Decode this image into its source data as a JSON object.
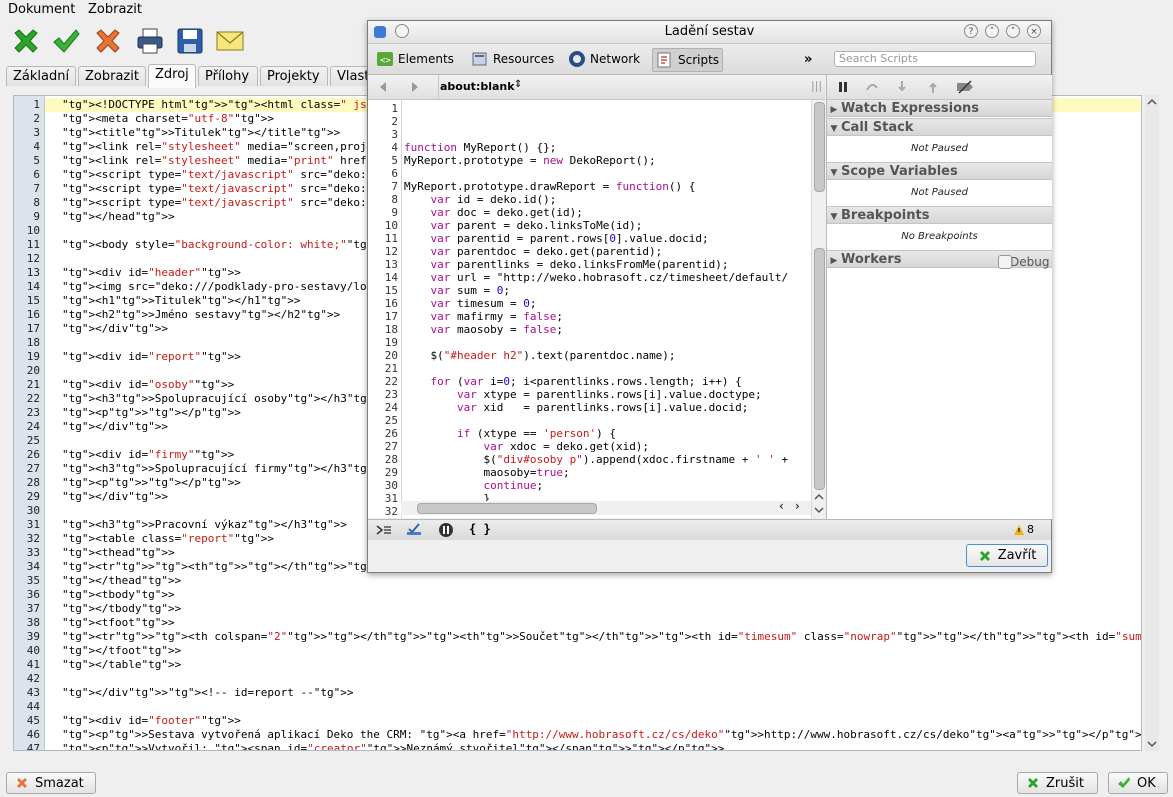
{
  "menu": {
    "items": [
      "Dokument",
      "Zobrazit"
    ]
  },
  "toolbar": {
    "icons": [
      "check-green-icon",
      "checkmark-icon",
      "cancel-icon",
      "print-icon",
      "save-icon",
      "email-icon"
    ]
  },
  "tabs": [
    "Základní",
    "Zobrazit",
    "Zdroj",
    "Přílohy",
    "Projekty",
    "Vlast"
  ],
  "active_tab": "Zdroj",
  "editor": {
    "lines": [
      {
        "n": "1",
        "t": "<!DOCTYPE html><html class=\" js\"><head>"
      },
      {
        "n": "2",
        "t": "<meta charset=\"utf-8\">"
      },
      {
        "n": "3",
        "t": "<title>Titulek</title>"
      },
      {
        "n": "4",
        "t": "<link rel=\"stylesheet\" media=\"screen,project"
      },
      {
        "n": "5",
        "t": "<link rel=\"stylesheet\" media=\"print\" href=\"d"
      },
      {
        "n": "6",
        "t": "<script type=\"text/javascript\" src=\"deko:///"
      },
      {
        "n": "7",
        "t": "<script type=\"text/javascript\" src=\"deko:///"
      },
      {
        "n": "8",
        "t": "<script type=\"text/javascript\" src=\"deko:///"
      },
      {
        "n": "9",
        "t": "</head>"
      },
      {
        "n": "10",
        "t": ""
      },
      {
        "n": "11",
        "t": "<body style=\"background-color: white;\">"
      },
      {
        "n": "12",
        "t": ""
      },
      {
        "n": "13",
        "t": "<div id=\"header\">"
      },
      {
        "n": "14",
        "t": "<img src=\"deko:///podklady-pro-sestavy/logo."
      },
      {
        "n": "15",
        "t": "<h1>Titulek</h1>"
      },
      {
        "n": "16",
        "t": "<h2>Jméno sestavy</h2>"
      },
      {
        "n": "17",
        "t": "</div>"
      },
      {
        "n": "18",
        "t": ""
      },
      {
        "n": "19",
        "t": "<div id=\"report\">"
      },
      {
        "n": "20",
        "t": ""
      },
      {
        "n": "21",
        "t": "<div id=\"osoby\">"
      },
      {
        "n": "22",
        "t": "<h3>Spolupracující osoby</h3>"
      },
      {
        "n": "23",
        "t": "<p></p>"
      },
      {
        "n": "24",
        "t": "</div>"
      },
      {
        "n": "25",
        "t": ""
      },
      {
        "n": "26",
        "t": "<div id=\"firmy\">"
      },
      {
        "n": "27",
        "t": "<h3>Spolupracující firmy</h3>"
      },
      {
        "n": "28",
        "t": "<p></p>"
      },
      {
        "n": "29",
        "t": "</div>"
      },
      {
        "n": "30",
        "t": ""
      },
      {
        "n": "31",
        "t": "<h3>Pracovní výkaz</h3>"
      },
      {
        "n": "32",
        "t": "<table class=\"report\">"
      },
      {
        "n": "33",
        "t": "<thead>"
      },
      {
        "n": "34",
        "t": "<tr><th></th><th class=\"right\">Datum</th><th"
      },
      {
        "n": "35",
        "t": "</thead>"
      },
      {
        "n": "36",
        "t": "<tbody>"
      },
      {
        "n": "37",
        "t": "</tbody>"
      },
      {
        "n": "38",
        "t": "<tfoot>"
      },
      {
        "n": "39",
        "t": "<tr><th colspan=\"2\"></th><th>Součet</th><th id=\"timesum\" class=\"nowrap\"></th><th id=\"sum\"></th></tr>"
      },
      {
        "n": "40",
        "t": "</tfoot>"
      },
      {
        "n": "41",
        "t": "</table>"
      },
      {
        "n": "42",
        "t": ""
      },
      {
        "n": "43",
        "t": "</div><!-- id=report -->"
      },
      {
        "n": "44",
        "t": ""
      },
      {
        "n": "45",
        "t": "<div id=\"footer\">"
      },
      {
        "n": "46",
        "t": "<p>Sestava vytvořená aplikací Deko the CRM: <a href=\"http://www.hobrasoft.cz/cs/deko\">http://www.hobrasoft.cz/cs/deko<a></p>"
      },
      {
        "n": "47",
        "t": "<p>Vytvořil: <span id=\"creator\">Neznámý stvořitel</span></p>"
      }
    ]
  },
  "bottom_buttons": {
    "delete": "Smazat",
    "cancel": "Zrušit",
    "ok": "OK"
  },
  "dialog": {
    "title": "Ladění sestav",
    "window_buttons": [
      "?",
      "˅",
      "˄",
      "×"
    ],
    "tabs": [
      "Elements",
      "Resources",
      "Network",
      "Scripts"
    ],
    "active_tab": "Scripts",
    "more": "»",
    "search_placeholder": "Search Scripts",
    "script_select": "about:blank",
    "code_lines": [
      {
        "n": "1",
        "t": ""
      },
      {
        "n": "2",
        "t": ""
      },
      {
        "n": "3",
        "t": ""
      },
      {
        "n": "4",
        "t": "function MyReport() {};"
      },
      {
        "n": "5",
        "t": "MyReport.prototype = new DekoReport();"
      },
      {
        "n": "6",
        "t": ""
      },
      {
        "n": "7",
        "t": "MyReport.prototype.drawReport = function() {"
      },
      {
        "n": "8",
        "t": "    var id = deko.id();"
      },
      {
        "n": "9",
        "t": "    var doc = deko.get(id);"
      },
      {
        "n": "10",
        "t": "    var parent = deko.linksToMe(id);"
      },
      {
        "n": "11",
        "t": "    var parentid = parent.rows[0].value.docid;"
      },
      {
        "n": "12",
        "t": "    var parentdoc = deko.get(parentid);"
      },
      {
        "n": "13",
        "t": "    var parentlinks = deko.linksFromMe(parentid);"
      },
      {
        "n": "14",
        "t": "    var url = \"http://weko.hobrasoft.cz/timesheet/default/"
      },
      {
        "n": "15",
        "t": "    var sum = 0;"
      },
      {
        "n": "16",
        "t": "    var timesum = 0;"
      },
      {
        "n": "17",
        "t": "    var mafirmy = false;"
      },
      {
        "n": "18",
        "t": "    var maosoby = false;"
      },
      {
        "n": "19",
        "t": ""
      },
      {
        "n": "20",
        "t": "    $(\"#header h2\").text(parentdoc.name);"
      },
      {
        "n": "21",
        "t": ""
      },
      {
        "n": "22",
        "t": "    for (var i=0; i<parentlinks.rows.length; i++) {"
      },
      {
        "n": "23",
        "t": "        var xtype = parentlinks.rows[i].value.doctype;"
      },
      {
        "n": "24",
        "t": "        var xid   = parentlinks.rows[i].value.docid;"
      },
      {
        "n": "25",
        "t": ""
      },
      {
        "n": "26",
        "t": "        if (xtype == 'person') {"
      },
      {
        "n": "27",
        "t": "            var xdoc = deko.get(xid);"
      },
      {
        "n": "28",
        "t": "            $(\"div#osoby p\").append(xdoc.firstname + ' ' +"
      },
      {
        "n": "29",
        "t": "            maosoby=true;"
      },
      {
        "n": "30",
        "t": "            continue;"
      },
      {
        "n": "31",
        "t": "            }"
      },
      {
        "n": "32",
        "t": ""
      }
    ],
    "sections": [
      {
        "title": "Watch Expressions",
        "body": "",
        "open": false
      },
      {
        "title": "Call Stack",
        "body": "Not Paused",
        "open": true
      },
      {
        "title": "Scope Variables",
        "body": "Not Paused",
        "open": true
      },
      {
        "title": "Breakpoints",
        "body": "No Breakpoints",
        "open": true
      },
      {
        "title": "Workers",
        "body": "",
        "open": false
      }
    ],
    "debug_label": "Debug",
    "warning_count": "8",
    "close_label": "Zavřít"
  }
}
